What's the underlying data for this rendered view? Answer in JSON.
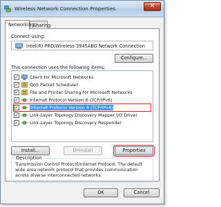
{
  "window": {
    "title": "Wireless Network Connection Properties",
    "close_symbol": "✕",
    "title_icon": "network-connection-icon"
  },
  "tabs": [
    {
      "label": "Networking",
      "active": true
    },
    {
      "label": "Sharing",
      "active": false
    }
  ],
  "connect_using": {
    "label": "Connect using:",
    "adapter": "Intel(R) PRO/Wireless 3945ABG Network Connection",
    "adapter_icon": "network-adapter-icon",
    "configure_label": "Configure..."
  },
  "items_section": {
    "label": "This connection uses the following items:",
    "items": [
      {
        "label": "Client for Microsoft Networks",
        "checked": true,
        "icon": "client-icon",
        "selected": false
      },
      {
        "label": "QoS Packet Scheduler",
        "checked": true,
        "icon": "service-icon",
        "selected": false
      },
      {
        "label": "File and Printer Sharing for Microsoft Networks",
        "checked": true,
        "icon": "service-icon",
        "selected": false
      },
      {
        "label": "Internet Protocol Version 6 (TCP/IPv6)",
        "checked": true,
        "icon": "protocol-icon",
        "selected": false
      },
      {
        "label": "Internet Protocol Version 4 (TCP/IPv4)",
        "checked": true,
        "icon": "protocol-icon",
        "selected": true
      },
      {
        "label": "Link-Layer Topology Discovery Mapper I/O Driver",
        "checked": true,
        "icon": "protocol-icon",
        "selected": false
      },
      {
        "label": "Link-Layer Topology Discovery Responder",
        "checked": true,
        "icon": "protocol-icon",
        "selected": false
      }
    ]
  },
  "actions": {
    "install_label": "Install...",
    "uninstall_label": "Uninstall",
    "properties_label": "Properties"
  },
  "description": {
    "title": "Description",
    "text": "Transmission Control Protocol/Internet Protocol. The default wide area network protocol that provides communication across diverse interconnected networks."
  },
  "footer": {
    "ok_label": "OK",
    "cancel_label": "Cancel"
  },
  "colors": {
    "highlight_outline": "#d0222e",
    "selection": "#3399ff",
    "title_gradient": "#c4d8ee"
  }
}
